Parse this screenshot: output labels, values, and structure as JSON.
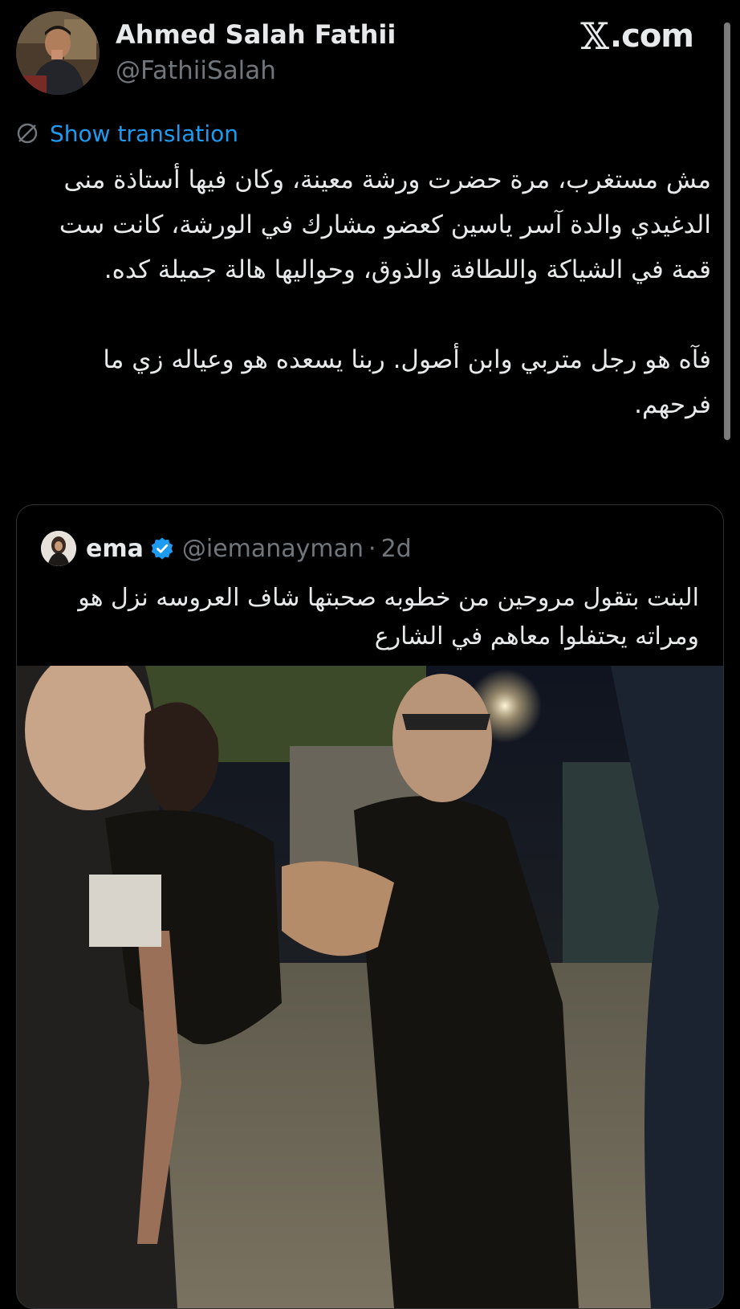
{
  "author": {
    "display_name": "Ahmed Salah Fathii",
    "handle": "@FathiiSalah",
    "avatar_icon": "profile-photo"
  },
  "site": {
    "logo_text": "com.",
    "logo_mark": "𝕏",
    "logo_label": "X.com"
  },
  "translation": {
    "label": "Show translation",
    "icon": "translate-globe-icon",
    "color": "#1d9bf0"
  },
  "tweet": {
    "paragraph_1": "مش مستغرب، مرة حضرت ورشة معينة، وكان فيها أستاذة منى الدغيدي والدة آسر ياسين كعضو مشارك في الورشة، كانت ست قمة في الشياكة واللطافة والذوق، وحواليها هالة جميلة كده.",
    "paragraph_2": "فآه هو رجل متربي وابن أصول. ربنا يسعده هو وعياله زي ما فرحهم."
  },
  "quoted_tweet": {
    "display_name": "ema",
    "verified": true,
    "verified_color": "#1d9bf0",
    "handle": "@iemanayman",
    "separator": "·",
    "time": "2d",
    "text": "البنت بتقول مروحين من خطوبه صحبتها شاف العروسه نزل هو ومراته يحتفلوا معاهم في الشارع",
    "media_description_icon": "video-thumbnail"
  },
  "colors": {
    "background": "#000000",
    "primary_text": "#e7e9ea",
    "secondary_text": "#71767b",
    "accent": "#1d9bf0",
    "border": "#2f3336"
  }
}
